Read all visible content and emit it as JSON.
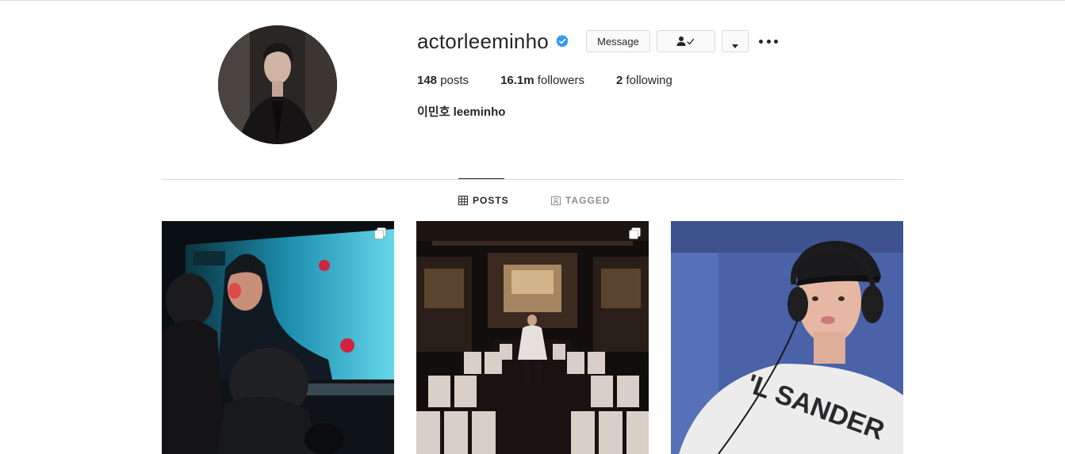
{
  "profile": {
    "username": "actorleeminho",
    "verified_icon": "verified-badge-icon",
    "full_name": "이민호 leeminho",
    "stats": {
      "posts_count": "148",
      "posts_label": "posts",
      "followers_count": "16.1m",
      "followers_label": "followers",
      "following_count": "2",
      "following_label": "following"
    }
  },
  "actions": {
    "message_label": "Message",
    "follow_icon": "person-check-icon",
    "dropdown_icon": "caret-down-icon",
    "more_icon": "more-options-icon"
  },
  "tabs": [
    {
      "label": "POSTS",
      "icon": "grid-icon",
      "active": true
    },
    {
      "label": "TAGGED",
      "icon": "tag-person-icon",
      "active": false
    }
  ],
  "posts": [
    {
      "type": "carousel",
      "icon": "carousel-icon"
    },
    {
      "type": "carousel",
      "icon": "carousel-icon"
    },
    {
      "type": "image"
    }
  ],
  "colors": {
    "text": "#262626",
    "muted": "#8e8e8e",
    "border": "#dbdbdb",
    "verified": "#3897f0"
  }
}
